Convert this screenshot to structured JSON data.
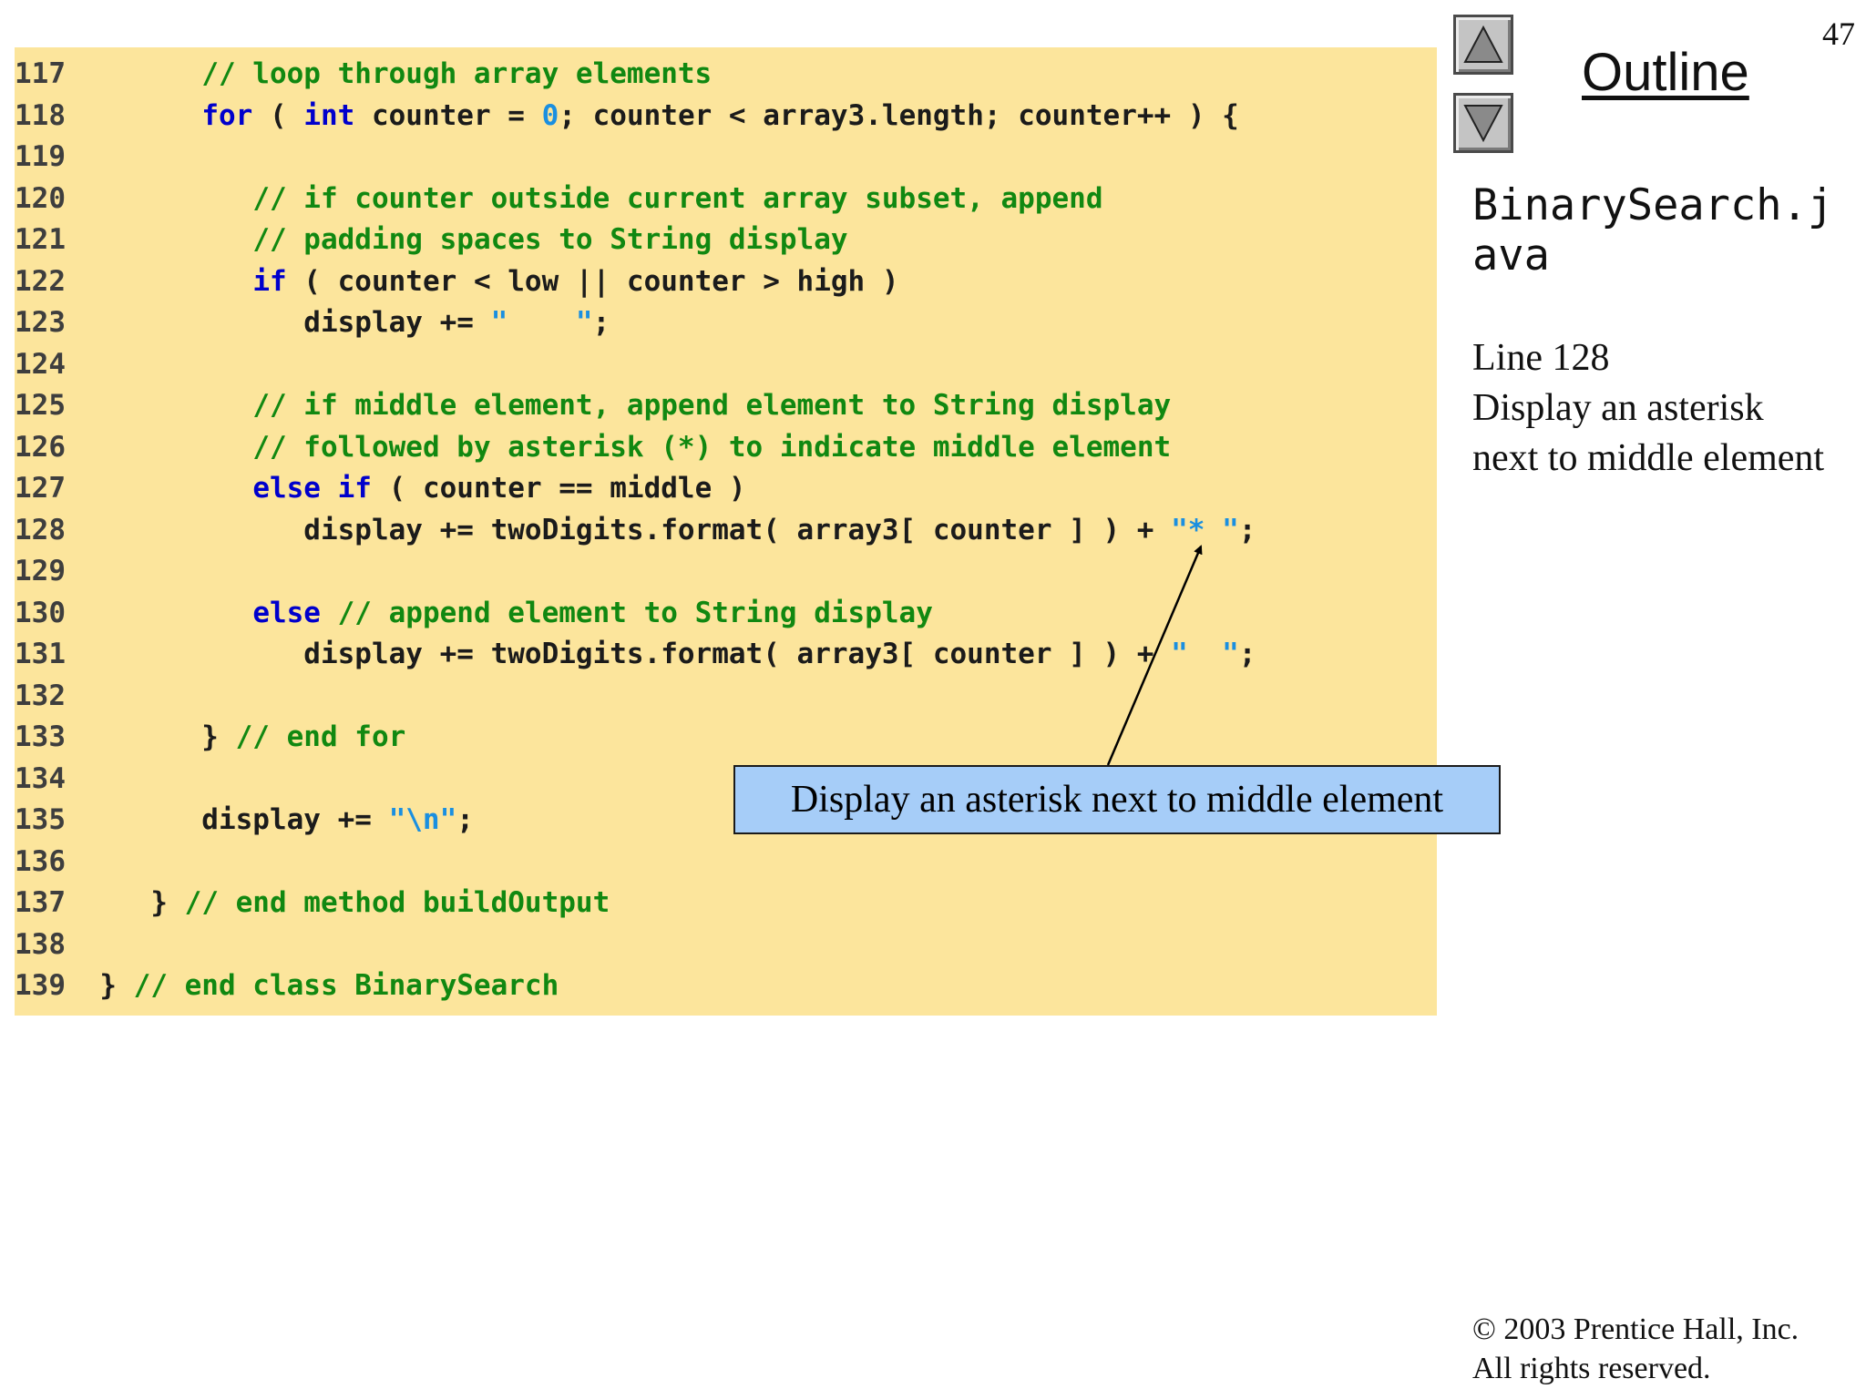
{
  "slide_number": "47",
  "outline_title": "Outline",
  "nav": {
    "up_icon": "triangle-up-icon",
    "down_icon": "triangle-down-icon"
  },
  "side_panel": {
    "file_name": "BinarySearch.java",
    "note_lines": [
      "Line 128",
      "Display an asterisk",
      "next to middle element"
    ]
  },
  "callout": {
    "text": "Display an asterisk next to middle element"
  },
  "footer": {
    "copyright": "© 2003 Prentice Hall, Inc.",
    "rights": "All rights reserved."
  },
  "colors": {
    "code_background": "#fce59c",
    "keyword": "#0000cc",
    "comment": "#118811",
    "string_literal": "#1a8fe0",
    "plain_text": "#1b1b1b",
    "callout_background": "#a6cdf8"
  },
  "code_lines": [
    {
      "n": "117",
      "tokens": [
        {
          "t": "pl",
          "v": "      "
        },
        {
          "t": "cm",
          "v": "// loop through array elements"
        }
      ]
    },
    {
      "n": "118",
      "tokens": [
        {
          "t": "pl",
          "v": "      "
        },
        {
          "t": "kw",
          "v": "for"
        },
        {
          "t": "pl",
          "v": " ( "
        },
        {
          "t": "kw",
          "v": "int"
        },
        {
          "t": "pl",
          "v": " counter = "
        },
        {
          "t": "st",
          "v": "0"
        },
        {
          "t": "pl",
          "v": "; counter < array3.length; counter++ ) {"
        }
      ]
    },
    {
      "n": "119",
      "tokens": []
    },
    {
      "n": "120",
      "tokens": [
        {
          "t": "pl",
          "v": "         "
        },
        {
          "t": "cm",
          "v": "// if counter outside current array subset, append"
        }
      ]
    },
    {
      "n": "121",
      "tokens": [
        {
          "t": "pl",
          "v": "         "
        },
        {
          "t": "cm",
          "v": "// padding spaces to String display"
        }
      ]
    },
    {
      "n": "122",
      "tokens": [
        {
          "t": "pl",
          "v": "         "
        },
        {
          "t": "kw",
          "v": "if"
        },
        {
          "t": "pl",
          "v": " ( counter < low || counter > high )"
        }
      ]
    },
    {
      "n": "123",
      "tokens": [
        {
          "t": "pl",
          "v": "            display += "
        },
        {
          "t": "st",
          "v": "\"    \""
        },
        {
          "t": "pl",
          "v": ";"
        }
      ]
    },
    {
      "n": "124",
      "tokens": []
    },
    {
      "n": "125",
      "tokens": [
        {
          "t": "pl",
          "v": "         "
        },
        {
          "t": "cm",
          "v": "// if middle element, append element to String display"
        }
      ]
    },
    {
      "n": "126",
      "tokens": [
        {
          "t": "pl",
          "v": "         "
        },
        {
          "t": "cm",
          "v": "// followed by asterisk (*) to indicate middle element"
        }
      ]
    },
    {
      "n": "127",
      "tokens": [
        {
          "t": "pl",
          "v": "         "
        },
        {
          "t": "kw",
          "v": "else if"
        },
        {
          "t": "pl",
          "v": " ( counter == middle )"
        }
      ]
    },
    {
      "n": "128",
      "tokens": [
        {
          "t": "pl",
          "v": "            display += twoDigits.format( array3[ counter ] ) + "
        },
        {
          "t": "st",
          "v": "\"* \""
        },
        {
          "t": "pl",
          "v": ";"
        }
      ]
    },
    {
      "n": "129",
      "tokens": []
    },
    {
      "n": "130",
      "tokens": [
        {
          "t": "pl",
          "v": "         "
        },
        {
          "t": "kw",
          "v": "else"
        },
        {
          "t": "pl",
          "v": " "
        },
        {
          "t": "cm",
          "v": "// append element to String display"
        }
      ]
    },
    {
      "n": "131",
      "tokens": [
        {
          "t": "pl",
          "v": "            display += twoDigits.format( array3[ counter ] ) + "
        },
        {
          "t": "st",
          "v": "\"  \""
        },
        {
          "t": "pl",
          "v": ";"
        }
      ]
    },
    {
      "n": "132",
      "tokens": []
    },
    {
      "n": "133",
      "tokens": [
        {
          "t": "pl",
          "v": "      } "
        },
        {
          "t": "cm",
          "v": "// end for"
        }
      ]
    },
    {
      "n": "134",
      "tokens": []
    },
    {
      "n": "135",
      "tokens": [
        {
          "t": "pl",
          "v": "      display += "
        },
        {
          "t": "st",
          "v": "\"\\n\""
        },
        {
          "t": "pl",
          "v": ";"
        }
      ]
    },
    {
      "n": "136",
      "tokens": []
    },
    {
      "n": "137",
      "tokens": [
        {
          "t": "pl",
          "v": "   } "
        },
        {
          "t": "cm",
          "v": "// end method buildOutput"
        }
      ]
    },
    {
      "n": "138",
      "tokens": []
    },
    {
      "n": "139",
      "tokens": [
        {
          "t": "pl",
          "v": "} "
        },
        {
          "t": "cm",
          "v": "// end class BinarySearch"
        }
      ]
    }
  ]
}
